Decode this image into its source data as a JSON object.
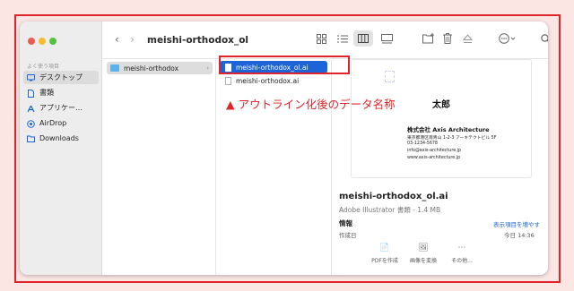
{
  "toolbar": {
    "back": "‹",
    "forward": "›",
    "title": "meishi-orthodox_ol",
    "icons": [
      "icon-view-grid",
      "list-view-icon",
      "column-view-icon",
      "gallery-view-icon",
      "new-folder-icon",
      "trash-icon",
      "eject-icon",
      "more-icon",
      "search-icon"
    ]
  },
  "sidebar": {
    "section_label": "よく使う項目",
    "items": [
      {
        "label": "デスクトップ",
        "icon": "desktop-icon",
        "selected": true
      },
      {
        "label": "書類",
        "icon": "document-icon",
        "selected": false
      },
      {
        "label": "アプリケー…",
        "icon": "apps-icon",
        "selected": false
      },
      {
        "label": "AirDrop",
        "icon": "airdrop-icon",
        "selected": false
      },
      {
        "label": "Downloads",
        "icon": "folder-icon",
        "selected": false
      }
    ]
  },
  "columns": {
    "col1": [
      {
        "label": "meishi-orthodox",
        "type": "folder"
      }
    ],
    "col2": [
      {
        "label": "meishi-orthodox_ol.ai",
        "type": "file",
        "selected": true
      },
      {
        "label": "meishi-orthodox.ai",
        "type": "file",
        "selected": false
      }
    ]
  },
  "preview": {
    "name": "太郎",
    "company": "株式会社 Axis Architecture",
    "lines": [
      "東京都港区南青山 1-2-3 アーキテクトビル 5F",
      "03-1234-5678",
      "info@axis-architecture.jp",
      "www.axis-architecture.jp"
    ]
  },
  "info": {
    "filename": "meishi-orthodox_ol.ai",
    "subtitle": "Adobe Illustrator 書類 - 1.4 MB",
    "header": "情報",
    "more_link": "表示項目を増やす",
    "row_label": "作成日",
    "row_value": "今日 14:36"
  },
  "actions": [
    {
      "label": "PDFを作成",
      "icon": "pdf-icon",
      "glyph": "📄"
    },
    {
      "label": "画像を変換",
      "icon": "image-icon",
      "glyph": "🖼"
    },
    {
      "label": "その他...",
      "icon": "more-icon",
      "glyph": "⋯"
    }
  ],
  "annotation": {
    "text": "アウトライン化後のデータ名称",
    "marker": "▲",
    "color": "#e0242a"
  }
}
